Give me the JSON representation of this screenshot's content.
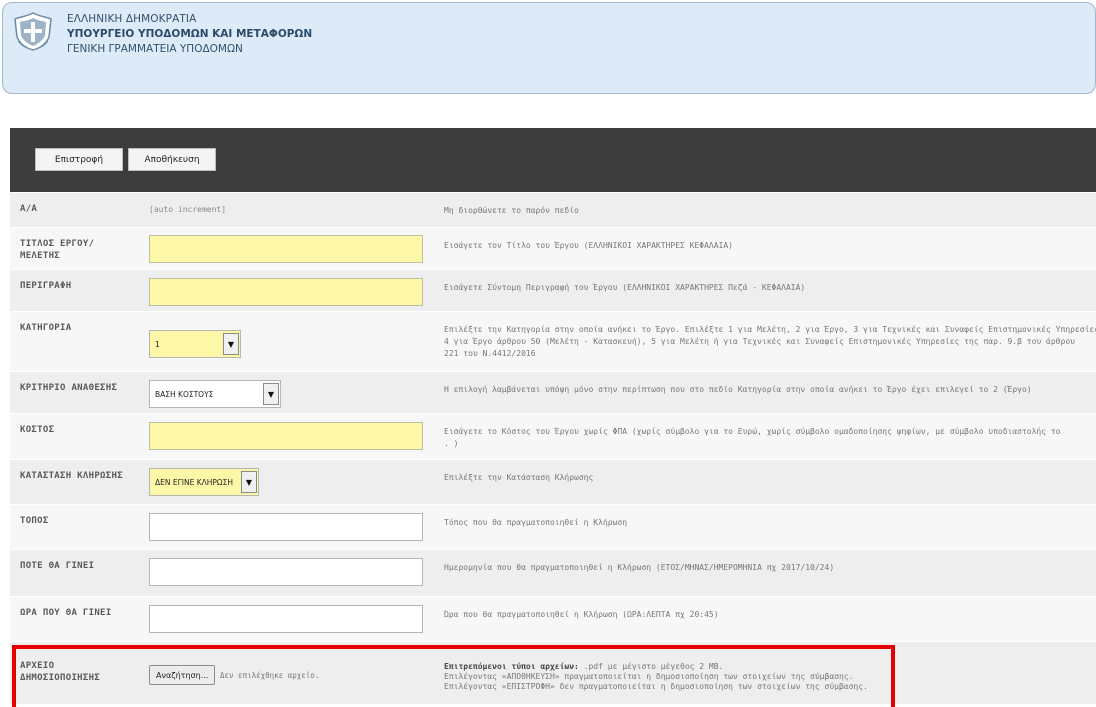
{
  "header": {
    "line1": "ΕΛΛΗΝΙΚΗ ΔΗΜΟΚΡΑΤΙΑ",
    "line2": "ΥΠΟΥΡΓΕΙΟ ΥΠΟΔΟΜΩΝ ΚΑΙ ΜΕΤΑΦΟΡΩΝ",
    "line3": "ΓΕΝΙΚΗ ΓΡΑΜΜΑΤΕΙΑ ΥΠΟΔΟΜΩΝ",
    "emblem_icon": "greek-coat-of-arms-icon"
  },
  "toolbar": {
    "back_label": "Επιστροφή",
    "save_label": "Αποθήκευση"
  },
  "form": {
    "aa": {
      "label": "A/A",
      "value": "[auto increment]",
      "hint": "Μη διορθώνετε το παρόν πεδίο"
    },
    "title": {
      "label": "ΤΙΤΛΟΣ ΕΡΓΟΥ/ ΜΕΛΕΤΗΣ",
      "value": "",
      "hint": "Εισάγετε τον Τίτλο του Έργου (ΕΛΛΗΝΙΚΟΙ ΧΑΡΑΚΤΗΡΕΣ ΚΕΦΑΛΑΙΑ)"
    },
    "description": {
      "label": "ΠΕΡΙΓΡΑΦΗ",
      "value": "",
      "hint": "Εισάγετε Σύντομη Περιγραφή του Έργου (ΕΛΛΗΝΙΚΟΙ ΧΑΡΑΚΤΗΡΕΣ Πεζά - ΚΕΦΑΛΑΙΑ)"
    },
    "category": {
      "label": "ΚΑΤΗΓΟΡΙΑ",
      "value": "1",
      "hint_l1": "Επιλέξτε την Κατηγορία στην οποία ανήκει το Έργο. Επιλέξτε 1 για Μελέτη, 2 για Έργο, 3 για Τεχνικές και Συναφείς Επιστημονικές Υπηρεσίες,",
      "hint_l2": "4 για Έργο άρθρου 50 (Μελέτη - Κατασκευή), 5 για Μελέτη ή για Τεχνικές και Συναφείς Επιστημονικές Υπηρεσίες της παρ. 9.β του άρθρου",
      "hint_l3": "221 του Ν.4412/2016"
    },
    "criterion": {
      "label": "ΚΡΙΤΗΡΙΟ ΑΝΑΘΕΣΗΣ",
      "value": "ΒΑΣΗ ΚΟΣΤΟΥΣ",
      "hint": "Η επιλογή λαμβάνεται υπόψη μόνο στην περίπτωση που στο πεδίο Κατηγορία στην οποία ανήκει το Έργο έχει επιλεγεί το 2 (Έργο)"
    },
    "cost": {
      "label": "ΚΟΣΤΟΣ",
      "value": "",
      "hint_l1": "Εισάγετε το Κόστος του Έργου χωρίς ΦΠΑ (χωρίς σύμβολο για το Ευρώ, χωρίς σύμβολο ομαδοποίησης ψηφίων, με σύμβολο υποδιαστολής το",
      "hint_l2": ". )"
    },
    "draw_status": {
      "label": "ΚΑΤΑΣΤΑΣΗ ΚΛΗΡΩΣΗΣ",
      "value": "ΔΕΝ ΕΓΙΝΕ ΚΛΗΡΩΣΗ",
      "hint": "Επιλέξτε την Κατάσταση Κλήρωσης"
    },
    "place": {
      "label": "ΤΟΠΟΣ",
      "value": "",
      "hint": "Τόπος που θα πραγματοποιηθεί η Κλήρωση"
    },
    "when": {
      "label": "ΠΟΤΕ ΘΑ ΓΙΝΕΙ",
      "value": "",
      "hint": "Ημερομηνία που θα πραγματοποιηθεί η Κλήρωση (ΕΤΟΣ/ΜΗΝΑΣ/ΗΜΕΡΟΜΗΝΙΑ πχ 2017/10/24)"
    },
    "time": {
      "label": "ΩΡΑ ΠΟΥ ΘΑ ΓΙΝΕΙ",
      "value": "",
      "hint": "Ώρα που θα πραγματοποιηθεί η Κλήρωση (ΩΡΑ:ΛΕΠΤΑ πχ 20:45)"
    },
    "file": {
      "label": "ΑΡΧΕΙΟ ΔΗΜΟΣΙΟΠΟΙΗΣΗΣ",
      "button": "Αναζήτηση...",
      "status": "Δεν επιλέχθηκε αρχείο.",
      "hint_bold": "Επιτρεπόμενοι τύποι αρχείων:",
      "hint_rest": " .pdf με μέγιστο μέγεθος 2 MB.",
      "hint_l2": "Επιλέγοντας «ΑΠΟΘΗΚΕΥΣΗ» πραγματοποιείται η δημοσιοποίηση των στοιχείων της σύμβασης.",
      "hint_l3": "Επιλέγοντας «ΕΠΙΣΤΡΟΦΗ» δεν πραγματοποιείται η δημοσιοποίηση των στοιχείων της σύμβασης."
    }
  }
}
